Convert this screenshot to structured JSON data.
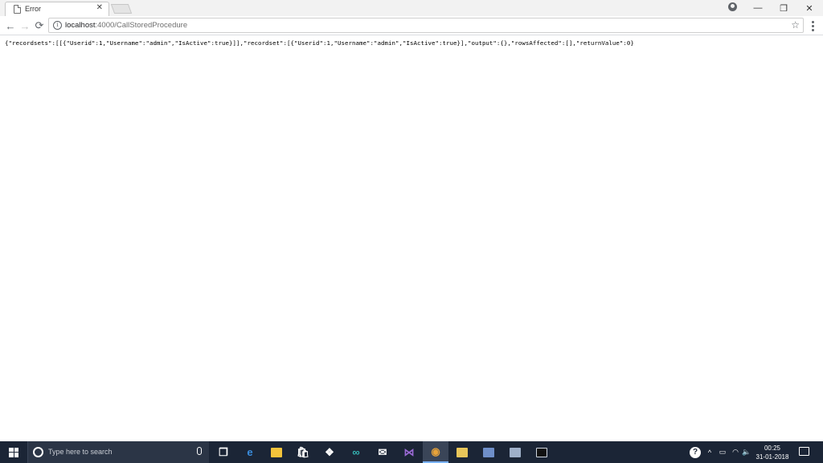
{
  "browser": {
    "tab": {
      "title": "Error",
      "close_glyph": "✕"
    },
    "window_controls": {
      "minimize": "—",
      "restore": "❐",
      "close": "✕"
    },
    "nav": {
      "back": "←",
      "forward": "→",
      "reload": "⟳"
    },
    "omnibox": {
      "host": "localhost",
      "rest": ":4000/CallStoredProcedure",
      "info_glyph": "i",
      "star_glyph": "☆"
    }
  },
  "page": {
    "body_text": "{\"recordsets\":[[{\"Userid\":1,\"Username\":\"admin\",\"IsActive\":true}]],\"recordset\":[{\"Userid\":1,\"Username\":\"admin\",\"IsActive\":true}],\"output\":{},\"rowsAffected\":[],\"returnValue\":0}"
  },
  "taskbar": {
    "search_placeholder": "Type here to search",
    "apps": [
      {
        "name": "task-view-icon",
        "glyph": "❐",
        "color": "#ffffff"
      },
      {
        "name": "edge-icon",
        "glyph": "e",
        "color": "#3a8dde"
      },
      {
        "name": "file-explorer-icon",
        "glyph": "",
        "color": "#f3c33b"
      },
      {
        "name": "store-icon",
        "glyph": "🛍",
        "color": "#ffffff"
      },
      {
        "name": "dropbox-icon",
        "glyph": "❖",
        "color": "#ffffff"
      },
      {
        "name": "arduino-icon",
        "glyph": "∞",
        "color": "#35b6b4"
      },
      {
        "name": "mail-icon",
        "glyph": "✉",
        "color": "#ffffff"
      },
      {
        "name": "visual-studio-icon",
        "glyph": "⋈",
        "color": "#9b6ad6"
      },
      {
        "name": "chrome-icon",
        "glyph": "◉",
        "color": "#e8a33a"
      },
      {
        "name": "sql-server-icon",
        "glyph": "",
        "color": "#e8c65a"
      },
      {
        "name": "remote-desktop-icon",
        "glyph": "",
        "color": "#6f8fc9"
      },
      {
        "name": "tools-icon",
        "glyph": "",
        "color": "#9fb0c9"
      },
      {
        "name": "terminal-icon",
        "glyph": "",
        "color": "#111111"
      }
    ],
    "tray": {
      "help_glyph": "?",
      "chevron_glyph": "^",
      "battery_glyph": "▭",
      "wifi_glyph": "◠",
      "volume_glyph": "🔈"
    },
    "clock": {
      "time": "00:25",
      "date": "31-01-2018"
    }
  }
}
